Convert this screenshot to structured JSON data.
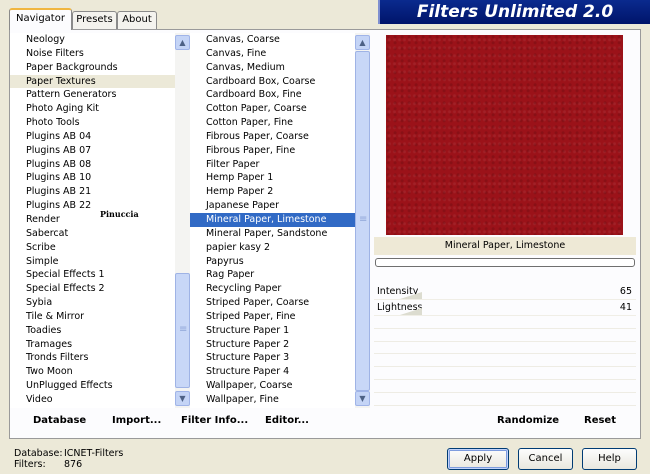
{
  "tabs": [
    "Navigator",
    "Presets",
    "About"
  ],
  "banner": {
    "title": "Filters Unlimited 2.0"
  },
  "categories": {
    "items": [
      "Neology",
      "Noise Filters",
      "Paper Backgrounds",
      "Paper Textures",
      "Pattern Generators",
      "Photo Aging Kit",
      "Photo Tools",
      "Plugins AB 04",
      "Plugins AB 07",
      "Plugins AB 08",
      "Plugins AB 10",
      "Plugins AB 21",
      "Plugins AB 22",
      "Render",
      "Sabercat",
      "Scribe",
      "Simple",
      "Special Effects 1",
      "Special Effects 2",
      "Sybia",
      "Tile & Mirror",
      "Toadies",
      "Tramages",
      "Tronds Filters",
      "Two Moon",
      "UnPlugged Effects",
      "Video"
    ],
    "selected_index": 3
  },
  "filters": {
    "items": [
      "Canvas, Coarse",
      "Canvas, Fine",
      "Canvas, Medium",
      "Cardboard Box, Coarse",
      "Cardboard Box, Fine",
      "Cotton Paper, Coarse",
      "Cotton Paper, Fine",
      "Fibrous Paper, Coarse",
      "Fibrous Paper, Fine",
      "Filter Paper",
      "Hemp Paper 1",
      "Hemp Paper 2",
      "Japanese Paper",
      "Mineral Paper, Limestone",
      "Mineral Paper, Sandstone",
      "papier kasy 2",
      "Papyrus",
      "Rag Paper",
      "Recycling Paper",
      "Striped Paper, Coarse",
      "Striped Paper, Fine",
      "Structure Paper 1",
      "Structure Paper 2",
      "Structure Paper 3",
      "Structure Paper 4",
      "Wallpaper, Coarse",
      "Wallpaper, Fine"
    ],
    "selected_index": 13
  },
  "preview": {
    "filter_name": "Mineral Paper, Limestone",
    "color": "#9b1219"
  },
  "sliders": [
    {
      "label": "Intensity",
      "value": "65"
    },
    {
      "label": "Lightness",
      "value": "41"
    }
  ],
  "bottom_buttons": {
    "database": "Database",
    "import": "Import...",
    "filter_info": "Filter Info...",
    "editor": "Editor...",
    "randomize": "Randomize",
    "reset": "Reset"
  },
  "status": {
    "database_label": "Database:",
    "database_value": "ICNET-Filters",
    "filters_label": "Filters:",
    "filters_value": "876"
  },
  "dialog_buttons": {
    "apply": "Apply",
    "cancel": "Cancel",
    "help": "Help"
  },
  "watermark": "Pinuccia",
  "icons": {
    "scroll_up": "▲",
    "scroll_down": "▼"
  }
}
